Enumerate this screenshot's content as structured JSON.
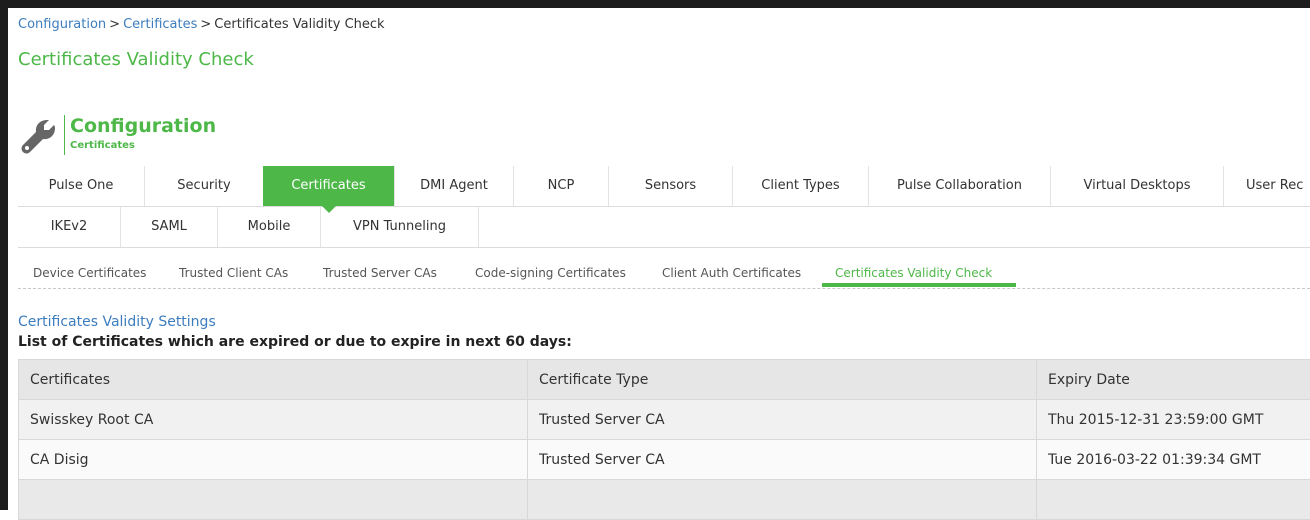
{
  "breadcrumb": {
    "items": [
      "Configuration",
      "Certificates",
      "Certificates Validity Check"
    ],
    "separator": ">"
  },
  "page_title": "Certificates Validity Check",
  "header": {
    "icon": "wrench-icon",
    "title": "Configuration",
    "subtitle": "Certificates"
  },
  "tabs": {
    "row1": [
      "Pulse One",
      "Security",
      "Certificates",
      "DMI Agent",
      "NCP",
      "Sensors",
      "Client Types",
      "Pulse Collaboration",
      "Virtual Desktops",
      "User Rec"
    ],
    "row2": [
      "IKEv2",
      "SAML",
      "Mobile",
      "VPN Tunneling"
    ],
    "active": "Certificates"
  },
  "subtabs": {
    "items": [
      "Device Certificates",
      "Trusted Client CAs",
      "Trusted Server CAs",
      "Code-signing Certificates",
      "Client Auth Certificates",
      "Certificates Validity Check"
    ],
    "active": "Certificates Validity Check"
  },
  "section": {
    "title": "Certificates Validity Settings",
    "description": "List of Certificates which are expired or due to expire in next 60 days:"
  },
  "table": {
    "columns": [
      "Certificates",
      "Certificate Type",
      "Expiry Date"
    ],
    "rows": [
      [
        "Swisskey Root CA",
        "Trusted Server CA",
        "Thu 2015-12-31 23:59:00 GMT"
      ],
      [
        "CA Disig",
        "Trusted Server CA",
        "Tue 2016-03-22 01:39:34 GMT"
      ],
      [
        "",
        "",
        ""
      ]
    ]
  },
  "colors": {
    "accent": "#4db848",
    "link": "#3d7dbf",
    "frame": "#1d1d1d"
  }
}
